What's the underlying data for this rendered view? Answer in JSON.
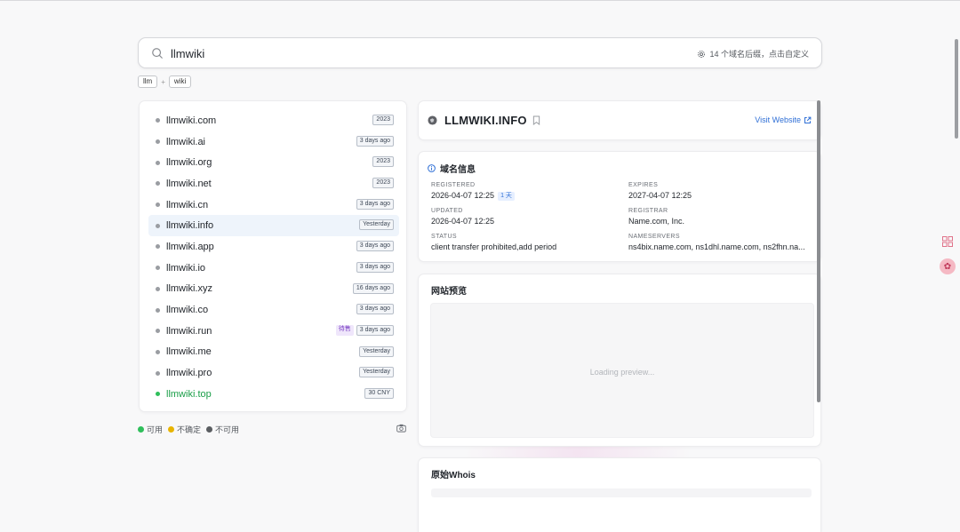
{
  "search": {
    "value": "llmwiki",
    "suffix_hint": "14 个域名后缀，点击自定义"
  },
  "tokens": [
    "llm",
    "wiki"
  ],
  "token_separator": "+",
  "domains": [
    {
      "name": "llmwiki.com",
      "badges": [
        "2023"
      ],
      "status": "unknown"
    },
    {
      "name": "llmwiki.ai",
      "badges": [
        "3 days ago"
      ],
      "status": "unknown"
    },
    {
      "name": "llmwiki.org",
      "badges": [
        "2023"
      ],
      "status": "unknown"
    },
    {
      "name": "llmwiki.net",
      "badges": [
        "2023"
      ],
      "status": "unknown"
    },
    {
      "name": "llmwiki.cn",
      "badges": [
        "3 days ago"
      ],
      "status": "unknown"
    },
    {
      "name": "llmwiki.info",
      "badges": [
        "Yesterday"
      ],
      "status": "unknown",
      "selected": true
    },
    {
      "name": "llmwiki.app",
      "badges": [
        "3 days ago"
      ],
      "status": "unknown"
    },
    {
      "name": "llmwiki.io",
      "badges": [
        "3 days ago"
      ],
      "status": "unknown"
    },
    {
      "name": "llmwiki.xyz",
      "badges": [
        "16 days ago"
      ],
      "status": "unknown"
    },
    {
      "name": "llmwiki.co",
      "badges": [
        "3 days ago"
      ],
      "status": "unknown"
    },
    {
      "name": "llmwiki.run",
      "sale_badge": "待售",
      "badges": [
        "3 days ago"
      ],
      "status": "unknown"
    },
    {
      "name": "llmwiki.me",
      "badges": [
        "Yesterday"
      ],
      "status": "unknown"
    },
    {
      "name": "llmwiki.pro",
      "badges": [
        "Yesterday"
      ],
      "status": "unknown"
    },
    {
      "name": "llmwiki.top",
      "badges": [
        "30 CNY"
      ],
      "status": "available"
    }
  ],
  "legend": {
    "available": "可用",
    "uncertain": "不确定",
    "unavailable": "不可用",
    "colors": {
      "available": "#2fbf5b",
      "uncertain": "#e8b400",
      "unavailable": "#5a5d61"
    }
  },
  "detail": {
    "domain": "LLMWIKI.INFO",
    "visit_label": "Visit Website",
    "info_title": "域名信息",
    "registered_label": "REGISTERED",
    "registered_value": "2026-04-07 12:25",
    "registered_pill": "1 天",
    "expires_label": "EXPIRES",
    "expires_value": "2027-04-07 12:25",
    "updated_label": "UPDATED",
    "updated_value": "2026-04-07 12:25",
    "registrar_label": "REGISTRAR",
    "registrar_value": "Name.com, Inc.",
    "status_label": "STATUS",
    "status_value": "client transfer prohibited,add period",
    "nameservers_label": "NAMESERVERS",
    "nameservers_value": "ns4bix.name.com, ns1dhl.name.com, ns2fhn.na...",
    "preview_title": "网站预览",
    "preview_loading": "Loading preview...",
    "whois_title": "原始Whois"
  },
  "colors": {
    "accent": "#2f6fd6",
    "available_text": "#1a9e48",
    "sale_badge": "#7b3fc4"
  }
}
